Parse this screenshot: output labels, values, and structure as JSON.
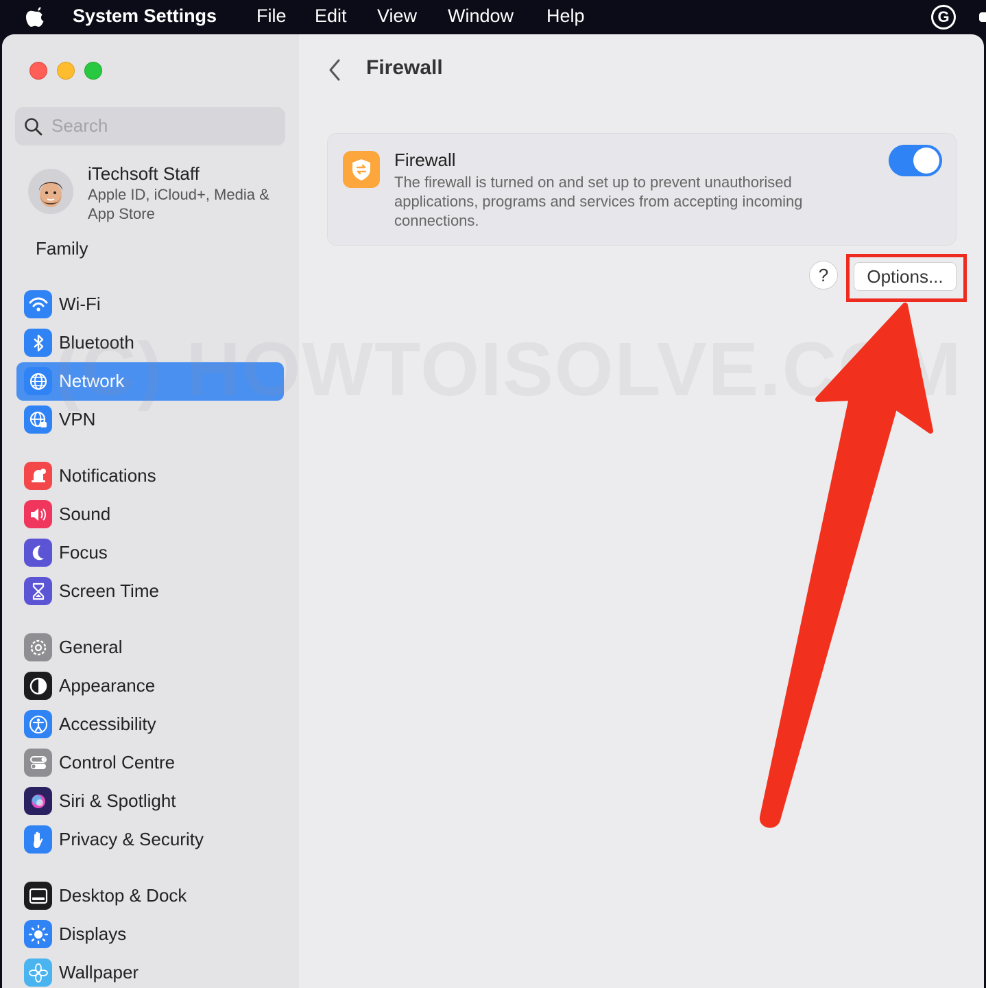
{
  "menubar": {
    "app_name": "System Settings",
    "items": [
      "File",
      "Edit",
      "View",
      "Window",
      "Help"
    ]
  },
  "search": {
    "placeholder": "Search"
  },
  "account": {
    "name": "iTechsoft Staff",
    "subtitle": "Apple ID, iCloud+, Media & App Store"
  },
  "family": "Family",
  "sidebar": {
    "items": [
      {
        "label": "Wi-Fi",
        "icon": "wifi-icon",
        "color": "#2f83f5"
      },
      {
        "label": "Bluetooth",
        "icon": "bluetooth-icon",
        "color": "#2f83f5"
      },
      {
        "label": "Network",
        "icon": "globe-icon",
        "color": "#2f83f5",
        "selected": true
      },
      {
        "label": "VPN",
        "icon": "vpn-globe-icon",
        "color": "#2f83f5"
      },
      {
        "label": "Notifications",
        "icon": "bell-icon",
        "color": "#f4474a"
      },
      {
        "label": "Sound",
        "icon": "speaker-icon",
        "color": "#f0365c"
      },
      {
        "label": "Focus",
        "icon": "moon-icon",
        "color": "#5b55d6"
      },
      {
        "label": "Screen Time",
        "icon": "hourglass-icon",
        "color": "#5b55d6"
      },
      {
        "label": "General",
        "icon": "gear-icon",
        "color": "#8e8e93"
      },
      {
        "label": "Appearance",
        "icon": "appearance-icon",
        "color": "#1c1c1e"
      },
      {
        "label": "Accessibility",
        "icon": "accessibility-icon",
        "color": "#2f83f5"
      },
      {
        "label": "Control Centre",
        "icon": "control-centre-icon",
        "color": "#8e8e93"
      },
      {
        "label": "Siri & Spotlight",
        "icon": "siri-icon",
        "color": "#3a2f7a"
      },
      {
        "label": "Privacy & Security",
        "icon": "hand-icon",
        "color": "#2f83f5"
      },
      {
        "label": "Desktop & Dock",
        "icon": "dock-icon",
        "color": "#1c1c1e"
      },
      {
        "label": "Displays",
        "icon": "sun-icon",
        "color": "#2f83f5"
      },
      {
        "label": "Wallpaper",
        "icon": "flower-icon",
        "color": "#4ab4f0"
      }
    ]
  },
  "main": {
    "title": "Firewall",
    "card": {
      "title": "Firewall",
      "description": "The firewall is turned on and set up to prevent unauthorised applications, programs and services from accepting incoming connections.",
      "toggle_on": true
    },
    "help_label": "?",
    "options_label": "Options..."
  },
  "watermark": "(C) HOWTOISOLVE.COM",
  "colors": {
    "accent": "#2f83f5",
    "selection": "#4a90f0",
    "annotation": "#ee2b1f",
    "firewall_icon": "#fda63b"
  }
}
